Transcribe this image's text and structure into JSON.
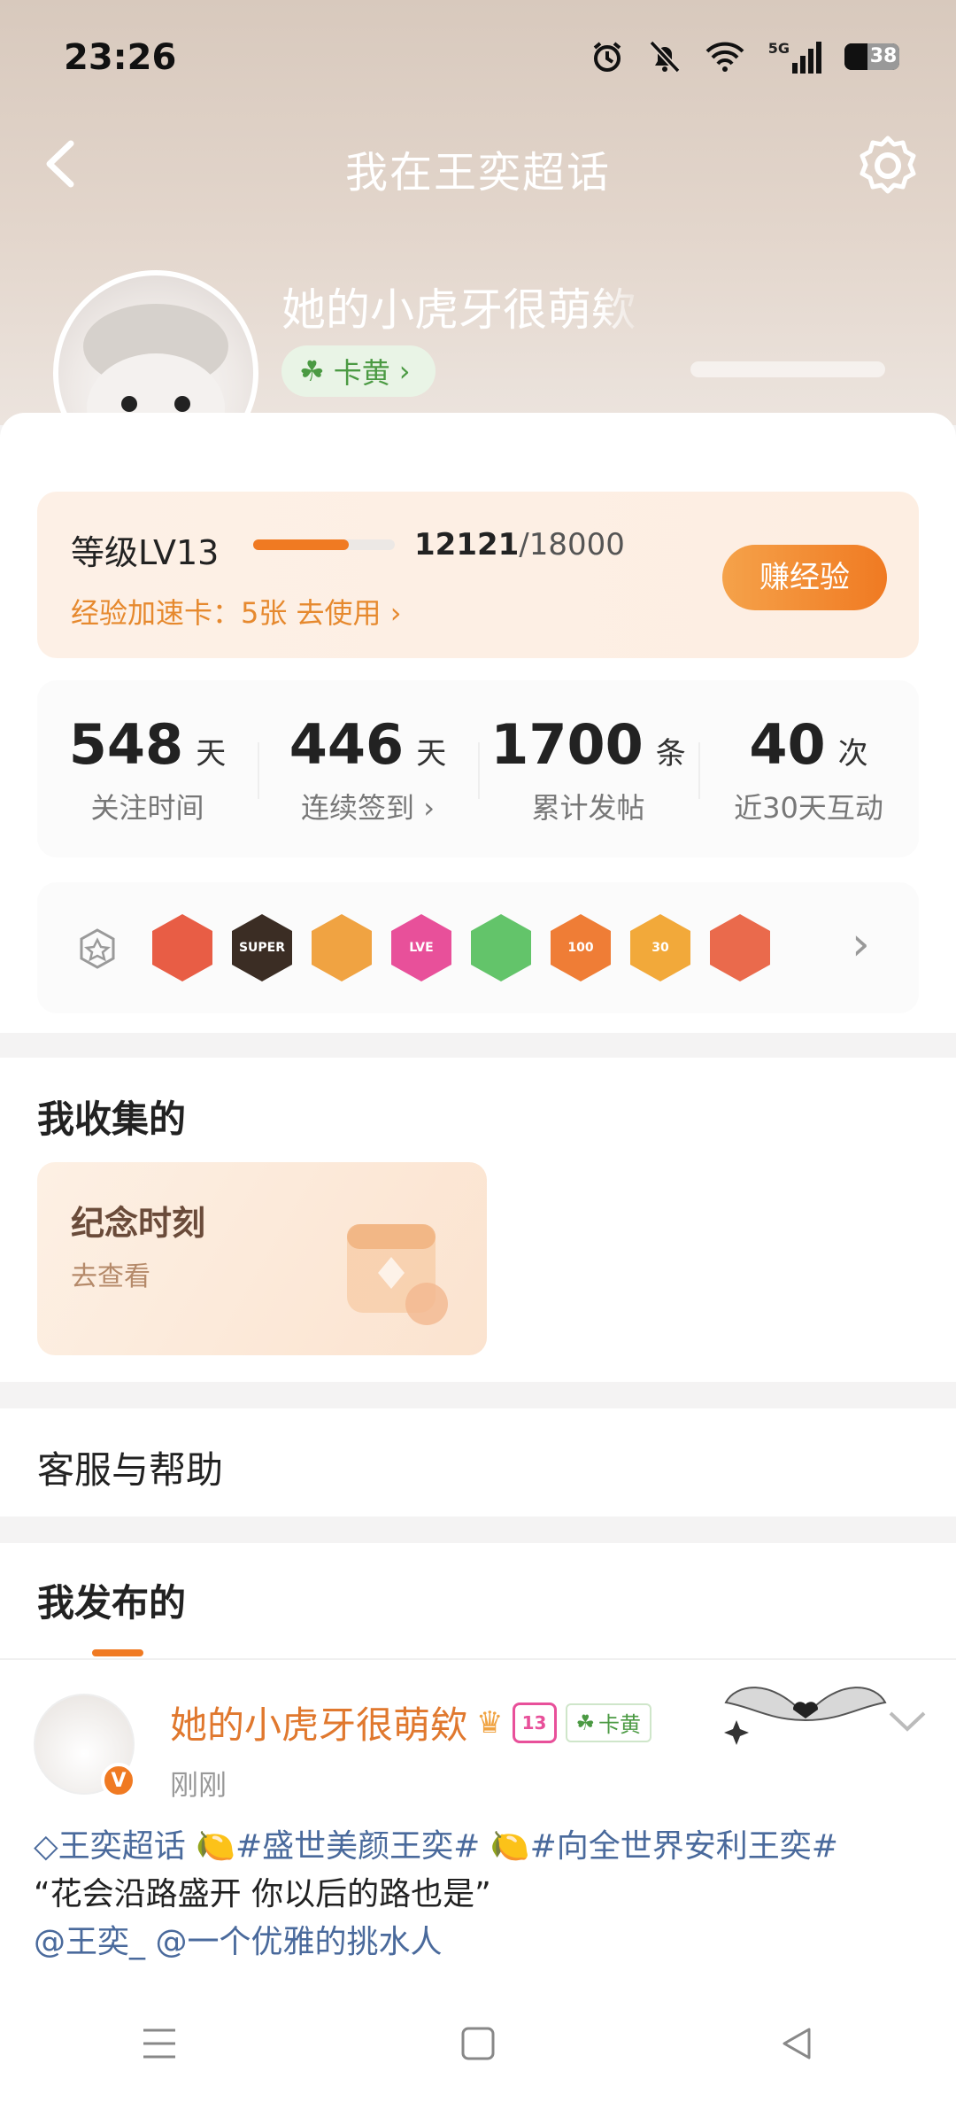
{
  "status_bar": {
    "time": "23:26",
    "battery": "38",
    "network": "5G"
  },
  "nav": {
    "title": "我在王奕超话"
  },
  "profile": {
    "username": "她的小虎牙很萌欸",
    "membership_label": "卡黄",
    "verified_badge": "V"
  },
  "level": {
    "label": "等级LV13",
    "exp_current": "12121",
    "exp_total": "/18000",
    "progress_fraction": 0.673,
    "boost_text": "经验加速卡：5张 去使用",
    "earn_button": "赚经验"
  },
  "stats": [
    {
      "value": "548",
      "unit": "天",
      "label": "关注时间"
    },
    {
      "value": "446",
      "unit": "天",
      "label": "连续签到"
    },
    {
      "value": "1700",
      "unit": "条",
      "label": "累计发帖"
    },
    {
      "value": "40",
      "unit": "次",
      "label": "近30天互动"
    }
  ],
  "badges": [
    {
      "icon": "tiger-badge-icon",
      "color": "#e85d45",
      "text": ""
    },
    {
      "icon": "super-crown-badge-icon",
      "color": "#3b2d24",
      "text": "SUPER"
    },
    {
      "icon": "crown-badge-icon",
      "color": "#f0a342",
      "text": ""
    },
    {
      "icon": "love-badge-icon",
      "color": "#e8509a",
      "text": "LVE"
    },
    {
      "icon": "hand-badge-icon",
      "color": "#63c46a",
      "text": ""
    },
    {
      "icon": "100-days-badge-icon",
      "color": "#ef7d36",
      "text": "100"
    },
    {
      "icon": "30-days-badge-icon",
      "color": "#f2a93a",
      "text": "30"
    },
    {
      "icon": "rock-hand-badge-icon",
      "color": "#ea6a4c",
      "text": ""
    }
  ],
  "collection": {
    "title": "我收集的",
    "card_title": "纪念时刻",
    "card_action": "去查看"
  },
  "help": {
    "title": "客服与帮助"
  },
  "posts": {
    "title": "我发布的"
  },
  "post": {
    "author": "她的小虎牙很萌欸",
    "level_badge": "13",
    "membership_tag": "卡黄",
    "time": "刚刚",
    "topic_line": "王奕超话",
    "tag1": "#盛世美颜王奕#",
    "tag2": "#向全世界安利王奕#",
    "quote": "“花会沿路盛开 你以后的路也是”",
    "mention1": "@王奕_",
    "mention2": "@一个优雅的挑水人"
  },
  "colors": {
    "accent": "#f07a22",
    "link": "#4a6a9c",
    "green": "#4b9a43"
  }
}
